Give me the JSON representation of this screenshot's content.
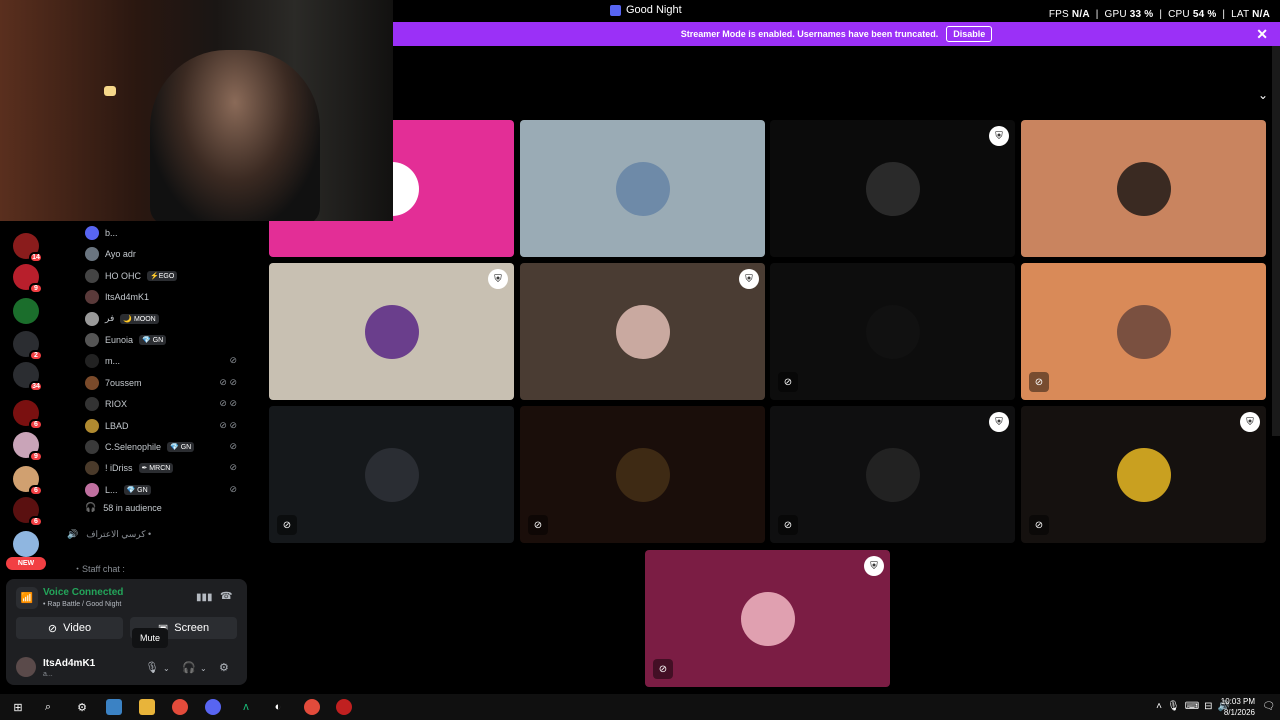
{
  "window_title": "Good Night",
  "perf": {
    "fps_label": "FPS",
    "fps_value": "N/A",
    "gpu_label": "GPU",
    "gpu_value": "33 %",
    "cpu_label": "CPU",
    "cpu_value": "54 %",
    "lat_label": "LAT",
    "lat_value": "N/A",
    "sep": "|"
  },
  "banner": {
    "text": "Streamer Mode is enabled. Usernames have been truncated.",
    "disable_label": "Disable"
  },
  "servers": [
    {
      "badge": "14",
      "color": "#8a1c1c"
    },
    {
      "badge": "9",
      "color": "#b81f2c"
    },
    {
      "badge": "",
      "color": "#1b6e2c"
    },
    {
      "badge": "2",
      "color": "#2b2d31"
    },
    {
      "badge": "34",
      "color": "#2b2d31"
    },
    {
      "badge": "6",
      "color": "#7a1010"
    },
    {
      "badge": "9",
      "color": "#c9a4b8"
    },
    {
      "badge": "6",
      "color": "#d0a070"
    },
    {
      "badge": "6",
      "color": "#5a1010"
    },
    {
      "badge": "",
      "color": "#8fb6e0"
    }
  ],
  "new_badge": "NEW",
  "members": [
    {
      "name": "b...",
      "tag": "",
      "mics": "",
      "color": "#5865f2"
    },
    {
      "name": "Ayo adr",
      "tag": "",
      "mics": "",
      "color": "#6a7580"
    },
    {
      "name": "HO OHC",
      "tag": "⚡EGO",
      "mics": "",
      "color": "#444"
    },
    {
      "name": "ItsAd4mK1",
      "tag": "",
      "mics": "",
      "color": "#5a3a3a"
    },
    {
      "name": "فر",
      "tag": "🌙 MOON",
      "mics": "",
      "color": "#999"
    },
    {
      "name": "Eunoia",
      "tag": "💎 GN",
      "mics": "",
      "color": "#555"
    },
    {
      "name": "m...",
      "tag": "",
      "mics": "⊘",
      "color": "#222"
    },
    {
      "name": "7oussem",
      "tag": "",
      "mics": "⊘ ⊘",
      "color": "#7a4a2a"
    },
    {
      "name": "RIOX",
      "tag": "",
      "mics": "⊘ ⊘",
      "color": "#333"
    },
    {
      "name": "LBAD",
      "tag": "",
      "mics": "⊘ ⊘",
      "color": "#b08a30"
    },
    {
      "name": "C.Selenophile",
      "tag": "💎 GN",
      "mics": "⊘",
      "color": "#3a3a3a"
    },
    {
      "name": "! iDriss",
      "tag": "✒ MRCN",
      "mics": "⊘",
      "color": "#4a3a2a"
    },
    {
      "name": "L...",
      "tag": "💎 GN",
      "mics": "⊘",
      "color": "#c070a0"
    }
  ],
  "audience_label": "58 in audience",
  "channel_arabic": "كرسي الاعتراف •",
  "channel_staff": "・Staff chat :",
  "voice": {
    "status": "Voice Connected",
    "sub": "• Rap Battle / Good Night",
    "video_label": "Video",
    "screen_label": "Screen"
  },
  "user": {
    "name": "ItsAd4mK1",
    "status": "a..."
  },
  "tooltip": "Mute",
  "tiles": [
    {
      "bg": "#e32e96",
      "avatar": "#ffffff",
      "shield": false,
      "mute": false
    },
    {
      "bg": "#9aabb5",
      "avatar": "#6e8aa8",
      "shield": false,
      "mute": false
    },
    {
      "bg": "#0b0b0b",
      "avatar": "#2a2a2a",
      "shield": true,
      "mute": false
    },
    {
      "bg": "#c9845f",
      "avatar": "#3a2a22",
      "shield": false,
      "mute": false
    },
    {
      "bg": "#c8c0b2",
      "avatar": "#6a3e8c",
      "shield": true,
      "mute": false
    },
    {
      "bg": "#4a3c33",
      "avatar": "#c9a9a0",
      "shield": true,
      "mute": false
    },
    {
      "bg": "#0d0d0d",
      "avatar": "#111111",
      "shield": false,
      "mute": true
    },
    {
      "bg": "#d98a58",
      "avatar": "#7a5040",
      "shield": false,
      "mute": true
    },
    {
      "bg": "#15181b",
      "avatar": "#2a2d33",
      "shield": false,
      "mute": true
    },
    {
      "bg": "#1a0e0a",
      "avatar": "#3e2a14",
      "shield": false,
      "mute": true
    },
    {
      "bg": "#0f0f10",
      "avatar": "#222222",
      "shield": true,
      "mute": true
    },
    {
      "bg": "#15110f",
      "avatar": "#c9a020",
      "shield": true,
      "mute": true
    },
    {
      "bg": "#7b1d44",
      "avatar": "#e0a0b0",
      "shield": true,
      "mute": true
    }
  ],
  "tray": {
    "time": "10:03 PM",
    "date": "8/1/2026"
  }
}
